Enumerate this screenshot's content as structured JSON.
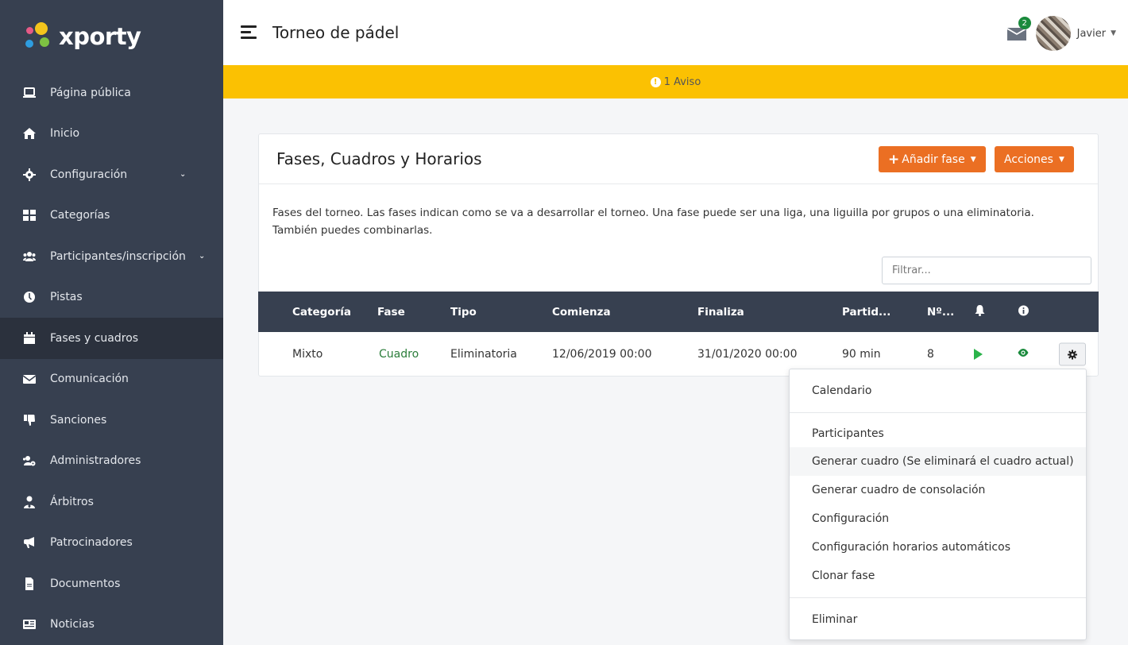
{
  "sidebar": {
    "brand": "xporty",
    "items": [
      {
        "label": "Página pública",
        "icon": "laptop-icon"
      },
      {
        "label": "Inicio",
        "icon": "home-icon"
      },
      {
        "label": "Configuración",
        "icon": "gear-icon",
        "has_submenu": true
      },
      {
        "label": "Categorías",
        "icon": "grid-icon"
      },
      {
        "label": "Participantes/inscripción",
        "icon": "users-icon",
        "has_submenu": true
      },
      {
        "label": "Pistas",
        "icon": "clock-icon"
      },
      {
        "label": "Fases y cuadros",
        "icon": "calendar-icon",
        "active": true
      },
      {
        "label": "Comunicación",
        "icon": "envelope-icon"
      },
      {
        "label": "Sanciones",
        "icon": "thumbs-down-icon"
      },
      {
        "label": "Administradores",
        "icon": "users-cog-icon"
      },
      {
        "label": "Árbitros",
        "icon": "user-tie-icon"
      },
      {
        "label": "Patrocinadores",
        "icon": "bullhorn-icon"
      },
      {
        "label": "Documentos",
        "icon": "file-icon"
      },
      {
        "label": "Noticias",
        "icon": "newspaper-icon"
      }
    ]
  },
  "header": {
    "title": "Torneo de pádel",
    "messages_count": "2",
    "user_name": "Javier"
  },
  "warning": {
    "text": "1 Aviso"
  },
  "card": {
    "title": "Fases, Cuadros y Horarios",
    "add_phase_label": "Añadir fase",
    "actions_label": "Acciones",
    "description": "Fases del torneo. Las fases indican como se va a desarrollar el torneo. Una fase puede ser una liga, una liguilla por grupos o una eliminatoria. También puedes combinarlas.",
    "filter_placeholder": "Filtrar..."
  },
  "table": {
    "headers": {
      "category": "Categoría",
      "phase": "Fase",
      "type": "Tipo",
      "starts": "Comienza",
      "ends": "Finaliza",
      "match": "Partid...",
      "number": "Nº..."
    },
    "row": {
      "category": "Mixto",
      "phase": "Cuadro",
      "type": "Eliminatoria",
      "starts": "12/06/2019 00:00",
      "ends": "31/01/2020 00:00",
      "match": "90 min",
      "number": "8"
    }
  },
  "dropdown": {
    "items": [
      "Calendario",
      "Participantes",
      "Generar cuadro (Se eliminará el cuadro actual)",
      "Generar cuadro de consolación",
      "Configuración",
      "Configuración horarios automáticos",
      "Clonar fase",
      "Eliminar"
    ]
  },
  "colors": {
    "sidebar_bg": "#374050",
    "accent_orange": "#eb6f23",
    "warning_yellow": "#fbc102",
    "link_green": "#2b7d3a"
  }
}
